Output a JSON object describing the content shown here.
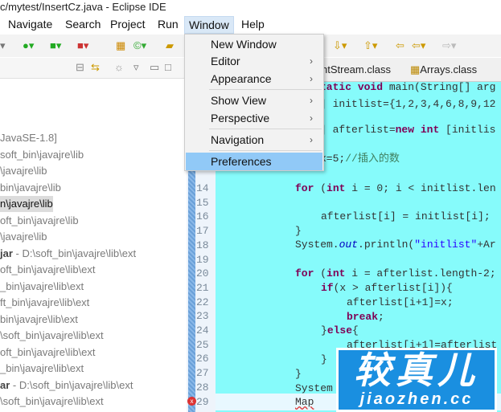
{
  "window": {
    "title": "c/mytest/InsertCz.java - Eclipse IDE"
  },
  "menubar": [
    "Navigate",
    "Search",
    "Project",
    "Run",
    "Window",
    "Help"
  ],
  "window_menu": {
    "items": [
      {
        "label": "New Window",
        "submenu": false
      },
      {
        "label": "Editor",
        "submenu": true
      },
      {
        "label": "Appearance",
        "submenu": true
      },
      {
        "label": "Show View",
        "submenu": true
      },
      {
        "label": "Perspective",
        "submenu": true
      },
      {
        "label": "Navigation",
        "submenu": true
      },
      {
        "label": "Preferences",
        "submenu": false,
        "highlighted": true
      }
    ],
    "arrow": "›"
  },
  "editor_tabs": [
    "ntStream.class",
    "Arrays.class"
  ],
  "tree": [
    {
      "a": "",
      "b": "JavaSE-1.8]"
    },
    {
      "a": "",
      "b": "soft_bin\\javajre\\lib"
    },
    {
      "a": "",
      "b": "\\javajre\\lib"
    },
    {
      "a": "",
      "b": "bin\\javajre\\lib"
    },
    {
      "a": "",
      "b": "n\\javajre\\lib",
      "selected": true
    },
    {
      "a": "",
      "b": "oft_bin\\javajre\\lib"
    },
    {
      "a": "",
      "b": "\\javajre\\lib"
    },
    {
      "a": "jar",
      "b": " - D:\\soft_bin\\javajre\\lib\\ext"
    },
    {
      "a": "",
      "b": "oft_bin\\javajre\\lib\\ext"
    },
    {
      "a": "",
      "b": "_bin\\javajre\\lib\\ext"
    },
    {
      "a": "",
      "b": "ft_bin\\javajre\\lib\\ext"
    },
    {
      "a": "",
      "b": "bin\\javajre\\lib\\ext"
    },
    {
      "a": "",
      "b": "\\soft_bin\\javajre\\lib\\ext"
    },
    {
      "a": "",
      "b": "oft_bin\\javajre\\lib\\ext"
    },
    {
      "a": "",
      "b": "_bin\\javajre\\lib\\ext"
    },
    {
      "a": "ar",
      "b": " - D:\\soft_bin\\javajre\\lib\\ext"
    },
    {
      "a": "",
      "b": "\\soft_bin\\javajre\\lib\\ext"
    }
  ],
  "line_numbers": [
    "14",
    "15",
    "16",
    "17",
    "18",
    "19",
    "20",
    "21",
    "22",
    "23",
    "24",
    "25",
    "26",
    "27",
    "28",
    "29"
  ],
  "code": {
    "l_main": [
      "tatic ",
      "void",
      " main(String[] arg"
    ],
    "l_init": "] initlist={1,2,3,4,6,8,9,12",
    "l_after": [
      "] afterlist=",
      "new",
      " ",
      "int",
      " [initlis"
    ],
    "l_x": [
      "x=5;",
      "//插入的数"
    ],
    "l14": [
      "for",
      " (",
      "int",
      " i = 0; i < initlist.len"
    ],
    "l16": "afterlist[i] = initlist[i];",
    "l17": "}",
    "l18": [
      "System.",
      "out",
      ".println(",
      "\"initlist\"",
      "+Ar"
    ],
    "l20": [
      "for",
      " (",
      "int",
      " i = afterlist.length-2;"
    ],
    "l21": [
      "if",
      "(x > afterlist[i]){"
    ],
    "l22": "afterlist[i+1]=x;",
    "l23": [
      "break",
      ";"
    ],
    "l24": [
      "}",
      "else",
      "{"
    ],
    "l25": "afterlist[i+1]=afterlist",
    "l26": "}",
    "l27": "}",
    "l28": "System",
    "l29": "Map"
  },
  "watermark": {
    "text": "较真儿",
    "url": "jiaozhen.cc"
  }
}
